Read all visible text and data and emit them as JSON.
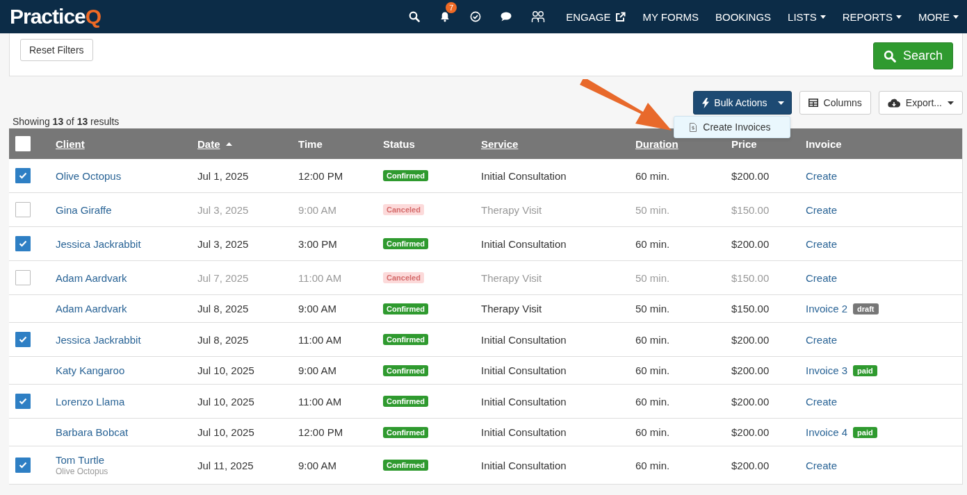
{
  "logo": {
    "text": "Practice",
    "accent": "Q"
  },
  "nav": {
    "icons": [
      {
        "kind": "search"
      },
      {
        "kind": "bell",
        "badge": "7"
      },
      {
        "kind": "check"
      },
      {
        "kind": "chat"
      },
      {
        "kind": "people"
      }
    ],
    "items": [
      {
        "label": "ENGAGE",
        "external": true,
        "dropdown": false
      },
      {
        "label": "MY FORMS",
        "external": false,
        "dropdown": false
      },
      {
        "label": "BOOKINGS",
        "external": false,
        "dropdown": false
      },
      {
        "label": "LISTS",
        "external": false,
        "dropdown": true
      },
      {
        "label": "REPORTS",
        "external": false,
        "dropdown": true
      },
      {
        "label": "MORE",
        "external": false,
        "dropdown": true
      }
    ]
  },
  "filters": {
    "reset": "Reset Filters",
    "search": "Search"
  },
  "toolbar": {
    "bulk": "Bulk Actions",
    "columns": "Columns",
    "export": "Export...",
    "menu": [
      {
        "label": "Create Invoices"
      }
    ]
  },
  "results": {
    "prefix": "Showing ",
    "shown": "13",
    "mid": " of ",
    "total": "13",
    "suffix": " results"
  },
  "table": {
    "select_all": {
      "checked": false
    },
    "columns": [
      {
        "label": "Client",
        "sortable": true,
        "sorted": false
      },
      {
        "label": "Date",
        "sortable": true,
        "sorted": true
      },
      {
        "label": "Time",
        "sortable": false,
        "sorted": false
      },
      {
        "label": "Status",
        "sortable": false,
        "sorted": false
      },
      {
        "label": "Service",
        "sortable": true,
        "sorted": false
      },
      {
        "label": "Duration",
        "sortable": true,
        "sorted": false
      },
      {
        "label": "Price",
        "sortable": false,
        "sorted": false
      },
      {
        "label": "Invoice",
        "sortable": false,
        "sorted": false
      }
    ],
    "rows": [
      {
        "selectable": true,
        "checked": true,
        "client": "Olive Octopus",
        "date": "Jul 1, 2025",
        "time": "12:00 PM",
        "status": {
          "label": "Confirmed",
          "kind": "confirmed"
        },
        "service": "Initial Consultation",
        "duration": "60 min.",
        "price": "$200.00",
        "invoice": {
          "label": "Create"
        }
      },
      {
        "selectable": true,
        "checked": false,
        "client": "Gina Giraffe",
        "date": "Jul 3, 2025",
        "time": "9:00 AM",
        "status": {
          "label": "Canceled",
          "kind": "canceled"
        },
        "service": "Therapy Visit",
        "duration": "50 min.",
        "price": "$150.00",
        "invoice": {
          "label": "Create"
        }
      },
      {
        "selectable": true,
        "checked": true,
        "client": "Jessica Jackrabbit",
        "date": "Jul 3, 2025",
        "time": "3:00 PM",
        "status": {
          "label": "Confirmed",
          "kind": "confirmed"
        },
        "service": "Initial Consultation",
        "duration": "60 min.",
        "price": "$200.00",
        "invoice": {
          "label": "Create"
        }
      },
      {
        "selectable": true,
        "checked": false,
        "client": "Adam Aardvark",
        "date": "Jul 7, 2025",
        "time": "11:00 AM",
        "status": {
          "label": "Canceled",
          "kind": "canceled"
        },
        "service": "Therapy Visit",
        "duration": "50 min.",
        "price": "$150.00",
        "invoice": {
          "label": "Create"
        }
      },
      {
        "selectable": false,
        "client": "Adam Aardvark",
        "date": "Jul 8, 2025",
        "time": "9:00 AM",
        "status": {
          "label": "Confirmed",
          "kind": "confirmed"
        },
        "service": "Therapy Visit",
        "duration": "50 min.",
        "price": "$150.00",
        "invoice": {
          "label": "Invoice 2",
          "tag": {
            "label": "draft",
            "kind": "draft"
          }
        }
      },
      {
        "selectable": true,
        "checked": true,
        "client": "Jessica Jackrabbit",
        "date": "Jul 8, 2025",
        "time": "11:00 AM",
        "status": {
          "label": "Confirmed",
          "kind": "confirmed"
        },
        "service": "Initial Consultation",
        "duration": "60 min.",
        "price": "$200.00",
        "invoice": {
          "label": "Create"
        }
      },
      {
        "selectable": false,
        "client": "Katy Kangaroo",
        "date": "Jul 10, 2025",
        "time": "9:00 AM",
        "status": {
          "label": "Confirmed",
          "kind": "confirmed"
        },
        "service": "Initial Consultation",
        "duration": "60 min.",
        "price": "$200.00",
        "invoice": {
          "label": "Invoice 3",
          "tag": {
            "label": "paid",
            "kind": "paid"
          }
        }
      },
      {
        "selectable": true,
        "checked": true,
        "client": "Lorenzo Llama",
        "date": "Jul 10, 2025",
        "time": "11:00 AM",
        "status": {
          "label": "Confirmed",
          "kind": "confirmed"
        },
        "service": "Initial Consultation",
        "duration": "60 min.",
        "price": "$200.00",
        "invoice": {
          "label": "Create"
        }
      },
      {
        "selectable": false,
        "client": "Barbara Bobcat",
        "date": "Jul 10, 2025",
        "time": "12:00 PM",
        "status": {
          "label": "Confirmed",
          "kind": "confirmed"
        },
        "service": "Initial Consultation",
        "duration": "60 min.",
        "price": "$200.00",
        "invoice": {
          "label": "Invoice 4",
          "tag": {
            "label": "paid",
            "kind": "paid"
          }
        }
      },
      {
        "selectable": true,
        "checked": true,
        "client": "Tom Turtle",
        "client_note": "Olive Octopus",
        "date": "Jul 11, 2025",
        "time": "9:00 AM",
        "status": {
          "label": "Confirmed",
          "kind": "confirmed"
        },
        "service": "Initial Consultation",
        "duration": "60 min.",
        "price": "$200.00",
        "invoice": {
          "label": "Create"
        }
      }
    ]
  }
}
